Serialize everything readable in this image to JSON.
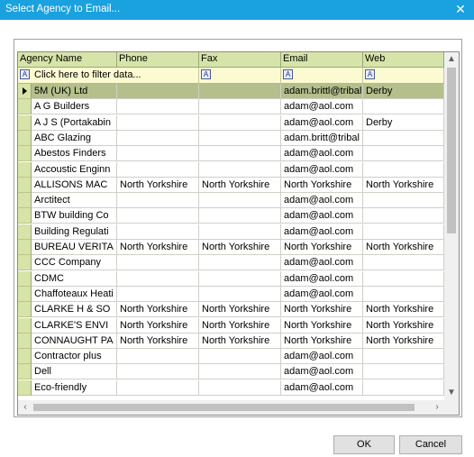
{
  "dialog": {
    "title": "Select Agency to Email...",
    "close_glyph": "✕",
    "ok_label": "OK",
    "cancel_label": "Cancel"
  },
  "grid": {
    "columns": [
      "Agency Name",
      "Phone",
      "Fax",
      "Email",
      "Web"
    ],
    "filter_placeholder": "Click here to filter data...",
    "filter_icon_glyph": "A",
    "scroll_up_glyph": "▲",
    "scroll_down_glyph": "▼",
    "scroll_left_glyph": "‹",
    "scroll_right_glyph": "›",
    "selected_row": 0,
    "rows": [
      [
        "5M (UK) Ltd",
        "",
        "",
        "adam.brittl@tribal",
        "Derby"
      ],
      [
        "A G Builders",
        "",
        "",
        "adam@aol.com",
        ""
      ],
      [
        "A J S (Portakabin",
        "",
        "",
        "adam@aol.com",
        "Derby"
      ],
      [
        "ABC Glazing",
        "",
        "",
        "adam.britt@tribal",
        ""
      ],
      [
        "Abestos Finders",
        "",
        "",
        "adam@aol.com",
        ""
      ],
      [
        "Accoustic Enginn",
        "",
        "",
        "adam@aol.com",
        ""
      ],
      [
        "ALLISONS MAC",
        "North Yorkshire",
        "North Yorkshire",
        "North Yorkshire",
        "North Yorkshire"
      ],
      [
        "Arctitect",
        "",
        "",
        "adam@aol.com",
        ""
      ],
      [
        "BTW building Co",
        "",
        "",
        "adam@aol.com",
        ""
      ],
      [
        "Building Regulati",
        "",
        "",
        "adam@aol.com",
        ""
      ],
      [
        "BUREAU VERITA",
        "North Yorkshire",
        "North Yorkshire",
        "North Yorkshire",
        "North Yorkshire"
      ],
      [
        "CCC Company",
        "",
        "",
        "adam@aol.com",
        ""
      ],
      [
        "CDMC",
        "",
        "",
        "adam@aol.com",
        ""
      ],
      [
        "Chaffoteaux Heati",
        "",
        "",
        "adam@aol.com",
        ""
      ],
      [
        "CLARKE H & SO",
        "North Yorkshire",
        "North Yorkshire",
        "North Yorkshire",
        "North Yorkshire"
      ],
      [
        "CLARKE'S ENVI",
        "North Yorkshire",
        "North Yorkshire",
        "North Yorkshire",
        "North Yorkshire"
      ],
      [
        "CONNAUGHT PA",
        "North Yorkshire",
        "North Yorkshire",
        "North Yorkshire",
        "North Yorkshire"
      ],
      [
        "Contractor plus",
        "",
        "",
        "adam@aol.com",
        ""
      ],
      [
        "Dell",
        "",
        "",
        "adam@aol.com",
        ""
      ],
      [
        "Eco-friendly",
        "",
        "",
        "adam@aol.com",
        ""
      ]
    ]
  }
}
